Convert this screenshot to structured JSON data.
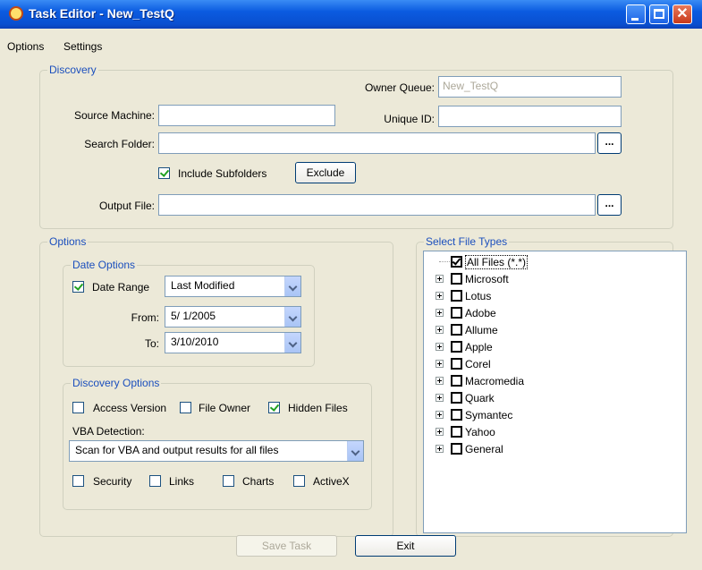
{
  "window": {
    "title": "Task Editor - New_TestQ"
  },
  "menu": [
    "Options",
    "Settings"
  ],
  "discovery": {
    "group_label": "Discovery",
    "owner_queue_label": "Owner Queue:",
    "owner_queue_value": "New_TestQ",
    "source_machine_label": "Source Machine:",
    "source_machine_value": "",
    "unique_id_label": "Unique ID:",
    "unique_id_value": "",
    "search_folder_label": "Search Folder:",
    "search_folder_value": "",
    "browse_label": "...",
    "include_subfolders_label": "Include Subfolders",
    "include_subfolders_checked": true,
    "exclude_label": "Exclude",
    "output_file_label": "Output File:",
    "output_file_value": ""
  },
  "options": {
    "group_label": "Options",
    "date_options": {
      "group_label": "Date Options",
      "date_range_label": "Date Range",
      "date_range_checked": true,
      "date_type": "Last Modified",
      "from_label": "From:",
      "from_value": "5/ 1/2005",
      "to_label": "To:",
      "to_value": "3/10/2010"
    },
    "discovery_options": {
      "group_label": "Discovery Options",
      "access_version_label": "Access Version",
      "file_owner_label": "File Owner",
      "hidden_files_label": "Hidden Files",
      "vba_detection_label": "VBA Detection:",
      "vba_detection_value": "Scan for VBA and output results for all files",
      "security_label": "Security",
      "links_label": "Links",
      "charts_label": "Charts",
      "activex_label": "ActiveX"
    }
  },
  "file_types": {
    "group_label": "Select File Types",
    "items": [
      {
        "label": "All Files (*.*)",
        "checked": true,
        "expandable": false
      },
      {
        "label": "Microsoft",
        "checked": false,
        "expandable": true
      },
      {
        "label": "Lotus",
        "checked": false,
        "expandable": true
      },
      {
        "label": "Adobe",
        "checked": false,
        "expandable": true
      },
      {
        "label": "Allume",
        "checked": false,
        "expandable": true
      },
      {
        "label": "Apple",
        "checked": false,
        "expandable": true
      },
      {
        "label": "Corel",
        "checked": false,
        "expandable": true
      },
      {
        "label": "Macromedia",
        "checked": false,
        "expandable": true
      },
      {
        "label": "Quark",
        "checked": false,
        "expandable": true
      },
      {
        "label": "Symantec",
        "checked": false,
        "expandable": true
      },
      {
        "label": "Yahoo",
        "checked": false,
        "expandable": true
      },
      {
        "label": "General",
        "checked": false,
        "expandable": true
      }
    ]
  },
  "footer": {
    "save_label": "Save Task",
    "exit_label": "Exit"
  }
}
